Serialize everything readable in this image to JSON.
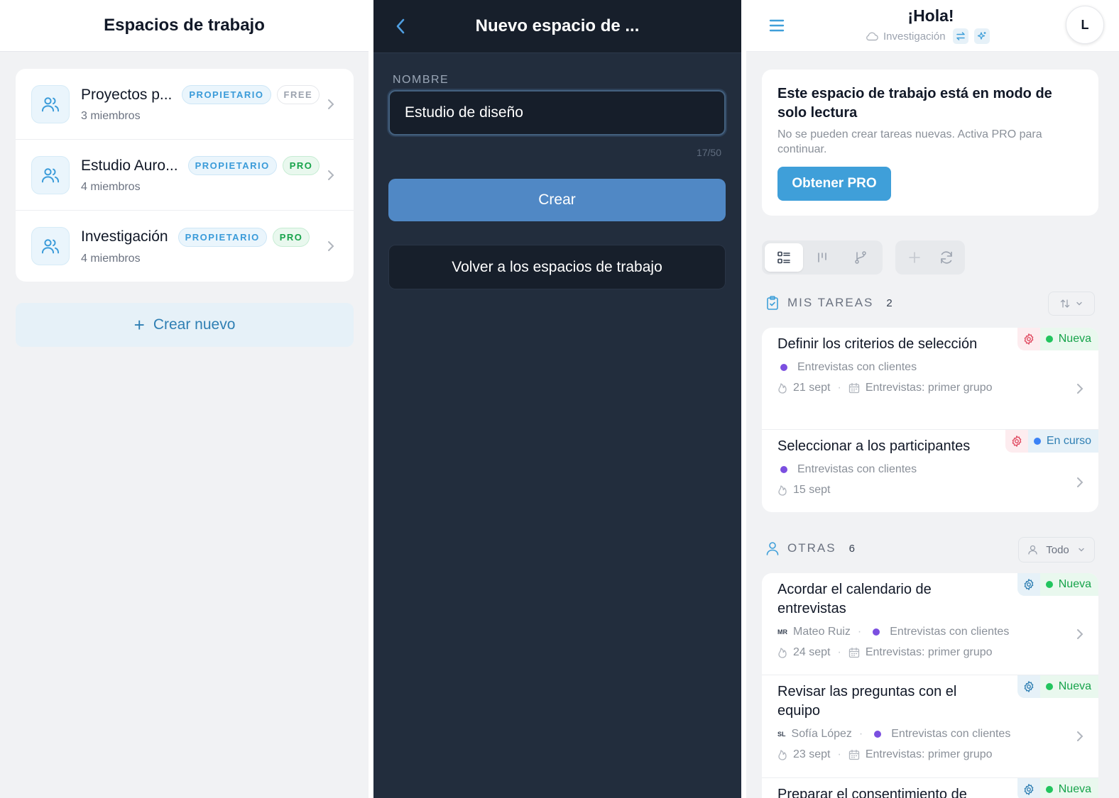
{
  "left": {
    "title": "Espacios de trabajo",
    "workspaces": [
      {
        "name": "Proyectos p...",
        "members": "3 miembros",
        "role": "PROPIETARIO",
        "plan": "FREE"
      },
      {
        "name": "Estudio Auro...",
        "members": "4 miembros",
        "role": "PROPIETARIO",
        "plan": "PRO"
      },
      {
        "name": "Investigación",
        "members": "4 miembros",
        "role": "PROPIETARIO",
        "plan": "PRO"
      }
    ],
    "create_label": "Crear nuevo"
  },
  "middle": {
    "title": "Nuevo espacio de ...",
    "field_label": "NOMBRE",
    "name_value": "Estudio de diseño",
    "counter": "17/50",
    "create_label": "Crear",
    "back_label": "Volver a los espacios de trabajo"
  },
  "right": {
    "greeting": "¡Hola!",
    "workspace": "Investigación",
    "avatar_initial": "L",
    "readonly": {
      "title": "Este espacio de trabajo está en modo de solo lectura",
      "description": "No se pueden crear tareas nuevas. Activa PRO para continuar.",
      "cta": "Obtener PRO"
    },
    "my_tasks": {
      "title": "MIS TAREAS",
      "count": "2",
      "tasks": [
        {
          "title": "Definir los criterios de selección",
          "project": "Entrevistas con clientes",
          "date": "21 sept",
          "sprint": "Entrevistas: primer grupo",
          "status": "Nueva"
        },
        {
          "title": "Seleccionar a los participantes",
          "project": "Entrevistas con clientes",
          "date": "15 sept",
          "status": "En curso"
        }
      ]
    },
    "others": {
      "title": "OTRAS",
      "count": "6",
      "filter": "Todo",
      "tasks": [
        {
          "title": "Acordar el calendario de entrevistas",
          "assignee_initials": "MR",
          "assignee": "Mateo Ruiz",
          "project": "Entrevistas con clientes",
          "date": "24 sept",
          "sprint": "Entrevistas: primer grupo",
          "status": "Nueva"
        },
        {
          "title": "Revisar las preguntas con el equipo",
          "assignee_initials": "SL",
          "assignee": "Sofía López",
          "project": "Entrevistas con clientes",
          "date": "23 sept",
          "sprint": "Entrevistas: primer grupo",
          "status": "Nueva"
        },
        {
          "title": "Preparar el consentimiento de",
          "status": "Nueva"
        }
      ]
    }
  },
  "colors": {
    "accent": "#3f9fd9",
    "dark_bg": "#222d3d",
    "status_green": "#16a34a",
    "status_blue": "#2f7fb3",
    "project_dot": "#7b4fe0"
  }
}
